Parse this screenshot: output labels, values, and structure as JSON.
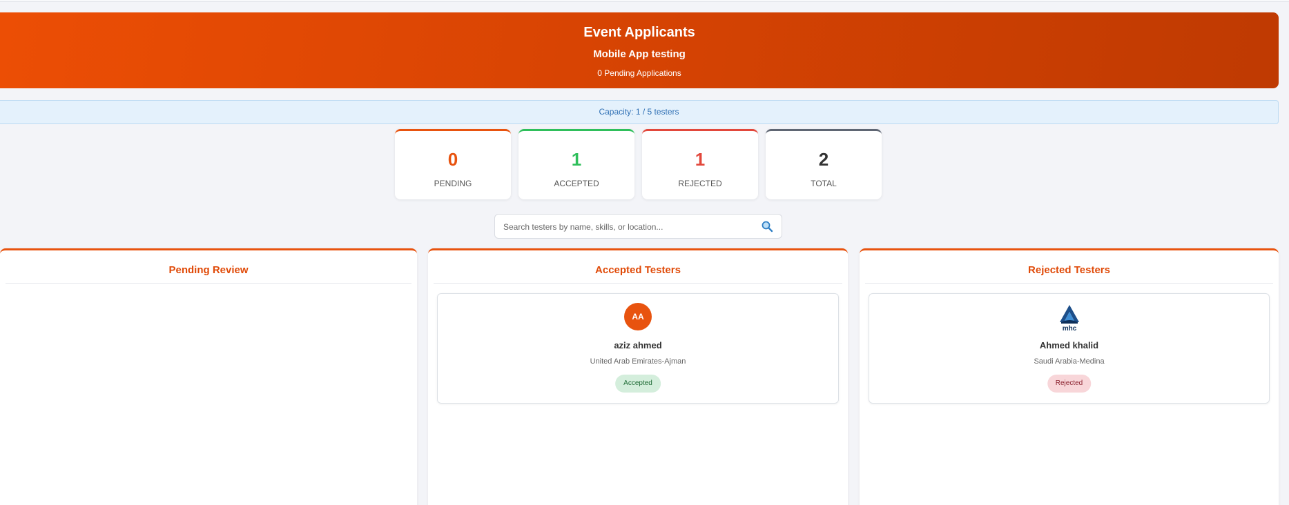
{
  "header": {
    "title": "Event Applicants",
    "event_name": "Mobile App testing",
    "pending_text": "0 Pending Applications"
  },
  "capacity": {
    "text": "Capacity: 1 / 5 testers"
  },
  "stats": [
    {
      "value": "0",
      "label": "PENDING",
      "color": "#e8530f"
    },
    {
      "value": "1",
      "label": "ACCEPTED",
      "color": "#2fbf5b"
    },
    {
      "value": "1",
      "label": "REJECTED",
      "color": "#e2473b"
    },
    {
      "value": "2",
      "label": "TOTAL",
      "color": "#5f6673"
    }
  ],
  "search": {
    "placeholder": "Search testers by name, skills, or location...",
    "icon": "search-icon"
  },
  "columns": {
    "pending": {
      "title": "Pending Review"
    },
    "accepted": {
      "title": "Accepted Testers",
      "card": {
        "initials": "AA",
        "name": "aziz ahmed",
        "location": "United Arab Emirates-Ajman",
        "status": "Accepted"
      }
    },
    "rejected": {
      "title": "Rejected Testers",
      "card": {
        "logo_text": "mhc",
        "name": "Ahmed khalid",
        "location": "Saudi Arabia-Medina",
        "status": "Rejected"
      }
    }
  },
  "colors": {
    "brand": "#e8530f",
    "accepted": "#2fbf5b",
    "rejected": "#e2473b",
    "total": "#5f6673"
  }
}
